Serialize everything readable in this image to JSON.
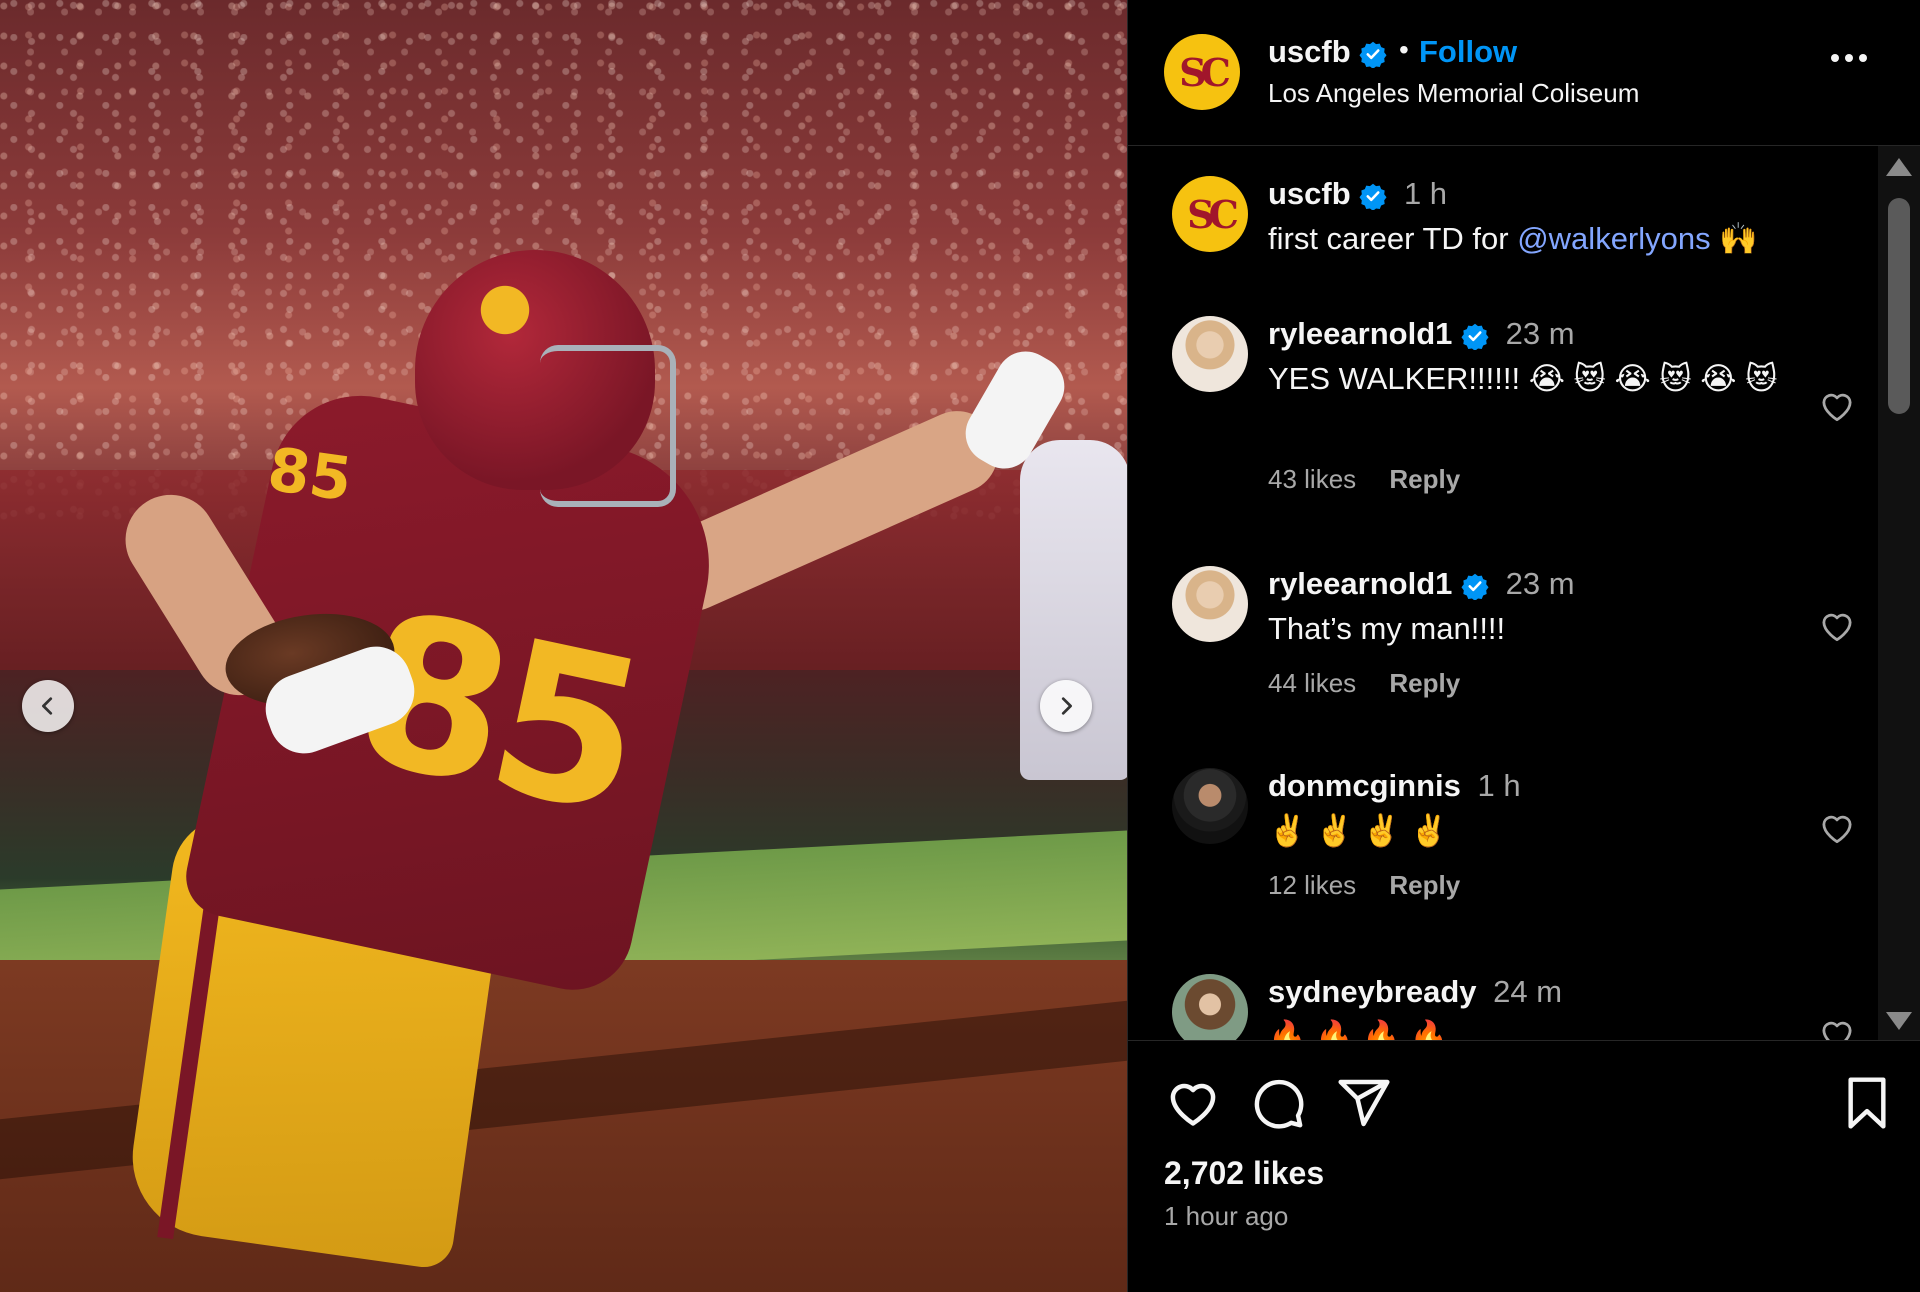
{
  "post": {
    "username": "uscfb",
    "location": "Los Angeles Memorial Coliseum",
    "follow_label": "Follow",
    "dot": "•",
    "avatar_text": "SC",
    "caption_username": "uscfb",
    "caption_time": "1 h",
    "caption_text": "first career TD for ",
    "caption_mention": "@walkerlyons",
    "caption_emoji": "🙌",
    "likes": "2,702 likes",
    "time_ago": "1 hour ago"
  },
  "comments": [
    {
      "username": "ryleearnold1",
      "time": "23 m",
      "text": "YES WALKER!!!!!! 😭 😻 😭 😻 😭 😻",
      "likes": "43 likes",
      "reply": "Reply"
    },
    {
      "username": "ryleearnold1",
      "time": "23 m",
      "text": "That’s my man!!!!",
      "likes": "44 likes",
      "reply": "Reply"
    },
    {
      "username": "donmcginnis",
      "time": "1 h",
      "text": "✌️ ✌️ ✌️ ✌️",
      "likes": "12 likes",
      "reply": "Reply"
    },
    {
      "username": "sydneybready",
      "time": "24 m",
      "text": "🔥 🔥 🔥 🔥"
    }
  ],
  "colors": {
    "accent_blue": "#0095f6",
    "mention": "#83a6ff",
    "usc_gold": "#f6c210",
    "usc_cardinal": "#a1162b",
    "background": "#000000"
  },
  "icons": [
    "verified-icon",
    "more-options-icon",
    "heart-icon",
    "comment-icon",
    "share-icon",
    "save-icon",
    "chevron-left-icon",
    "chevron-right-icon"
  ]
}
